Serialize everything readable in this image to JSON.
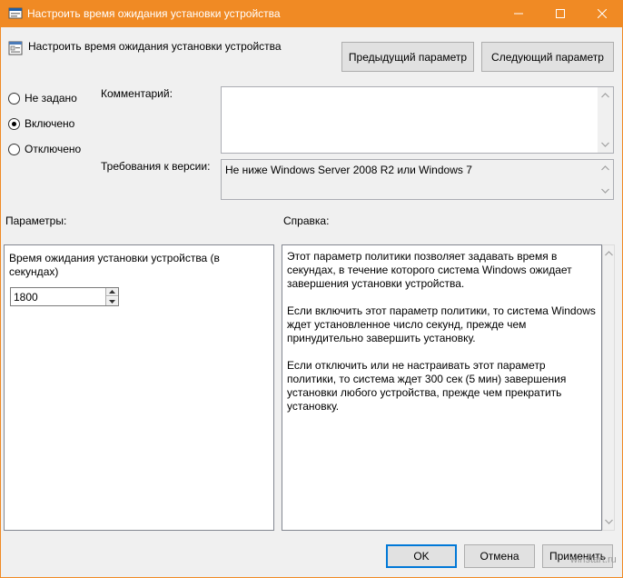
{
  "window": {
    "title": "Настроить время ожидания установки устройства",
    "accent_color": "#f08a24"
  },
  "header": {
    "title": "Настроить время ожидания установки устройства",
    "prev_button": "Предыдущий параметр",
    "next_button": "Следующий параметр"
  },
  "state": {
    "options": [
      {
        "label": "Не задано",
        "checked": false
      },
      {
        "label": "Включено",
        "checked": true
      },
      {
        "label": "Отключено",
        "checked": false
      }
    ]
  },
  "comment": {
    "label": "Комментарий:",
    "value": ""
  },
  "requirements": {
    "label": "Требования к версии:",
    "value": "Не ниже Windows Server 2008 R2 или Windows 7"
  },
  "options_section": {
    "heading": "Параметры:",
    "timeout_label": "Время ожидания установки устройства (в секундах)",
    "timeout_value": "1800"
  },
  "help_section": {
    "heading": "Справка:",
    "paragraphs": [
      "Этот параметр политики позволяет задавать время в секундах, в течение которого система Windows ожидает завершения установки устройства.",
      "Если включить этот параметр политики, то система Windows ждет установленное число секунд, прежде чем принудительно завершить установку.",
      "Если отключить или не настраивать этот параметр политики, то система ждет 300 сек (5 мин) завершения установки любого устройства, прежде чем прекратить установку."
    ]
  },
  "footer": {
    "ok": "OK",
    "cancel": "Отмена",
    "apply": "Применить"
  },
  "watermark": "winstart.ru",
  "icons": {
    "app": "policy-window-icon",
    "header": "policy-setting-icon",
    "minimize": "minimize-icon",
    "maximize": "maximize-icon",
    "close": "close-icon"
  }
}
